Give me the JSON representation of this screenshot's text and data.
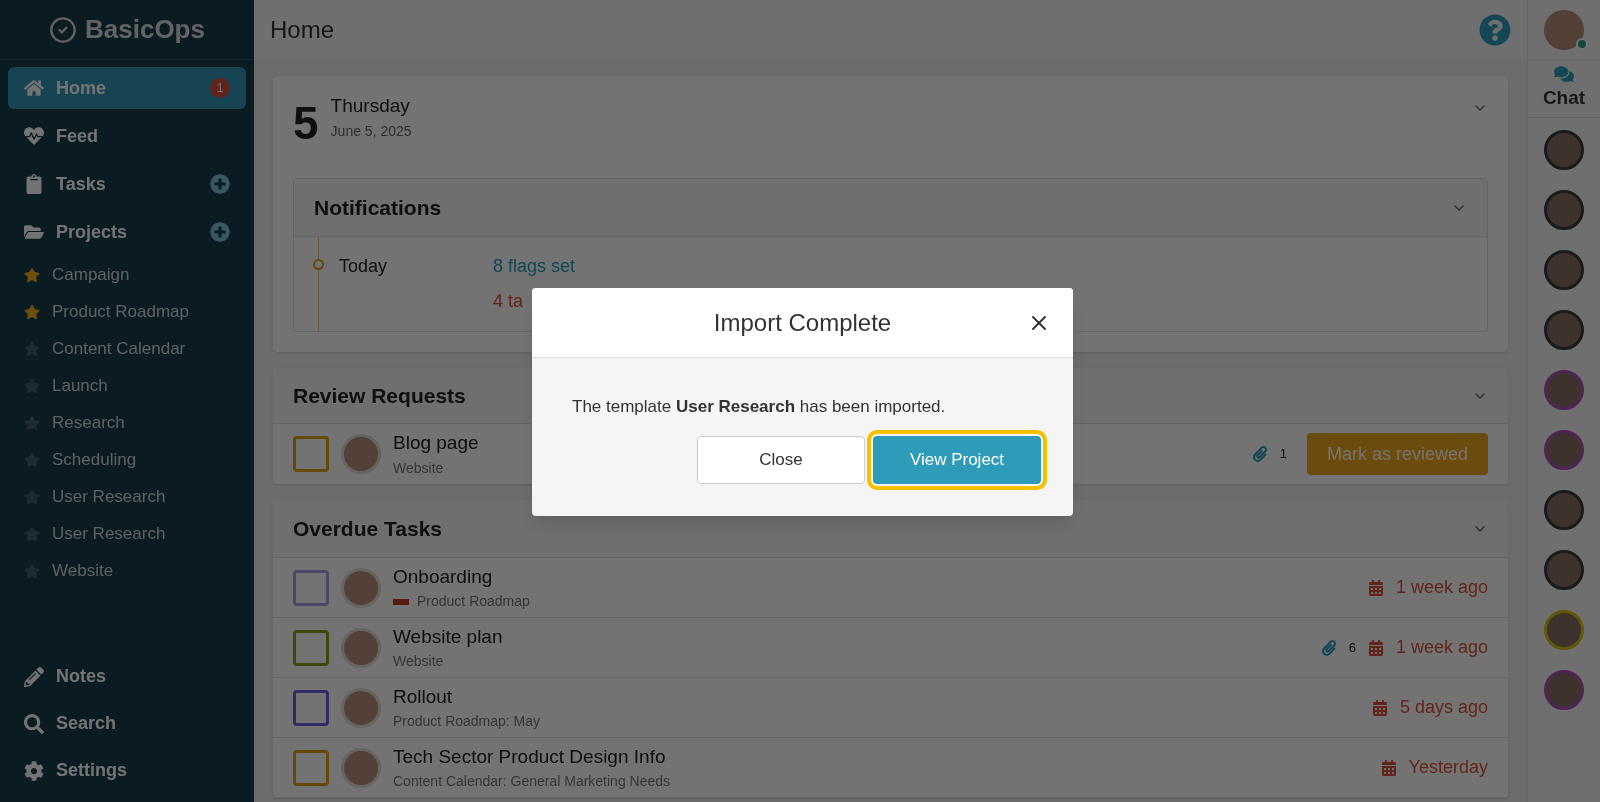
{
  "sidebar": {
    "logo": "BasicOps",
    "nav": [
      {
        "label": "Home",
        "kind": "home",
        "selected": true,
        "badge": "1"
      },
      {
        "label": "Feed",
        "kind": "feed",
        "selected": false
      },
      {
        "label": "Tasks",
        "kind": "tasks",
        "selected": false,
        "add": true
      },
      {
        "label": "Projects",
        "kind": "projects",
        "selected": false,
        "add": true
      }
    ],
    "projects": [
      {
        "label": "Campaign",
        "starred": true
      },
      {
        "label": "Product Roadmap",
        "starred": true
      },
      {
        "label": "Content Calendar",
        "starred": false
      },
      {
        "label": "Launch",
        "starred": false
      },
      {
        "label": "Research",
        "starred": false
      },
      {
        "label": "Scheduling",
        "starred": false
      },
      {
        "label": "User Research",
        "starred": false
      },
      {
        "label": "User Research",
        "starred": false
      },
      {
        "label": "Website",
        "starred": false
      }
    ],
    "bottom": [
      {
        "label": "Notes",
        "kind": "notes"
      },
      {
        "label": "Search",
        "kind": "search"
      },
      {
        "label": "Settings",
        "kind": "settings"
      }
    ]
  },
  "header": {
    "title": "Home"
  },
  "today": {
    "day": "5",
    "weekday": "Thursday",
    "date": "June 5, 2025"
  },
  "notifications": {
    "title": "Notifications",
    "groups": [
      {
        "label": "Today",
        "items": [
          {
            "text": "8 flags set",
            "kind": "info"
          },
          {
            "text": "4 ta",
            "kind": "alert"
          }
        ]
      }
    ]
  },
  "review_requests": {
    "title": "Review Requests",
    "items": [
      {
        "title": "Blog page",
        "project": "Website",
        "attachments": "1",
        "action": "Mark as reviewed",
        "color": "#654908"
      }
    ]
  },
  "overdue_tasks": {
    "title": "Overdue Tasks",
    "items": [
      {
        "title": "Onboarding",
        "project": "Product Roadmap",
        "flagged": true,
        "due": "1 week ago",
        "color": "#4c4665"
      },
      {
        "title": "Website plan",
        "project": "Website",
        "flagged": false,
        "attachments": "6",
        "due": "1 week ago",
        "color": "#40480e"
      },
      {
        "title": "Rollout",
        "project": "Product Roadmap: May",
        "flagged": false,
        "due": "5 days ago",
        "color": "#302b60"
      },
      {
        "title": "Tech Sector Product Design Info",
        "project": "Content Calendar: General Marketing Needs",
        "flagged": false,
        "due": "Yesterday",
        "color": "#654908"
      }
    ]
  },
  "user": {
    "online": true
  },
  "chat": {
    "label": "Chat",
    "avatars": [
      {
        "color": "#1a1a1a"
      },
      {
        "color": "#1a1a1a"
      },
      {
        "color": "#1a1a1a"
      },
      {
        "color": "#1a1a1a"
      },
      {
        "color": "#4f2453"
      },
      {
        "color": "#4f2453"
      },
      {
        "color": "#1a1a1a"
      },
      {
        "color": "#1a1a1a"
      },
      {
        "color": "#615709"
      },
      {
        "color": "#4f2453"
      }
    ]
  },
  "modal": {
    "title": "Import Complete",
    "message": "The template **User Research** has been imported.",
    "buttons": [
      {
        "label": "Close",
        "kind": "secondary",
        "focused": false
      },
      {
        "label": "View Project",
        "kind": "primary",
        "focused": true
      }
    ]
  }
}
